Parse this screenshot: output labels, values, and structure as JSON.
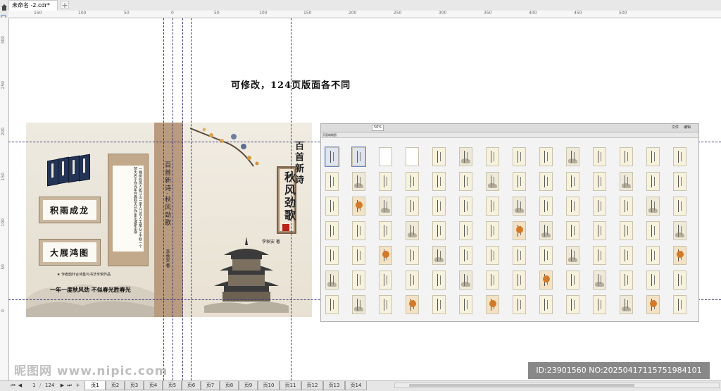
{
  "window": {
    "tab_title": "未命名 -2.cdr*",
    "add_tab": "+"
  },
  "ruler": {
    "h_ticks": [
      "150",
      "100",
      "50",
      "0",
      "50",
      "100",
      "150",
      "200",
      "250",
      "300",
      "350",
      "400",
      "450",
      "500"
    ],
    "v_ticks": [
      "300",
      "250",
      "200",
      "150",
      "100",
      "50",
      "0"
    ]
  },
  "canvas": {
    "caption": "可修改，124页版面各不同"
  },
  "cover": {
    "back": {
      "plaque1": "积雨成龙",
      "plaque2": "大展鸿图",
      "scroll_text": "一棵树似风人如江山一家人江鸟人手斌心宁千秋一个梦大名小你光年吟春秋天已作年东湖斯中寒",
      "author_note": "★ 作者韵朴合诗集与书法专辑作品",
      "slogan": "一年一度秋风劲 不似春光胜春光"
    },
    "spine": {
      "title": "百首新诗·秋风劲歌",
      "author": "李秋安 著"
    },
    "front": {
      "series": "百首新诗",
      "title": "秋风劲歌",
      "author": "李秋安 著"
    }
  },
  "screenshot": {
    "zoom": "56%",
    "menu_right": [
      "文件",
      "编辑"
    ],
    "header": "页面缩略图"
  },
  "bottom": {
    "page_current": "1",
    "page_of": "124",
    "pages": [
      "页1",
      "页2",
      "页3",
      "页4",
      "页5",
      "页6",
      "页7",
      "页8",
      "页9",
      "页10",
      "页11",
      "页12",
      "页13",
      "页14"
    ]
  },
  "watermark": {
    "site": "昵图网 www.nipic.com",
    "id": "ID:23901560 NO:20250417115751984101"
  }
}
